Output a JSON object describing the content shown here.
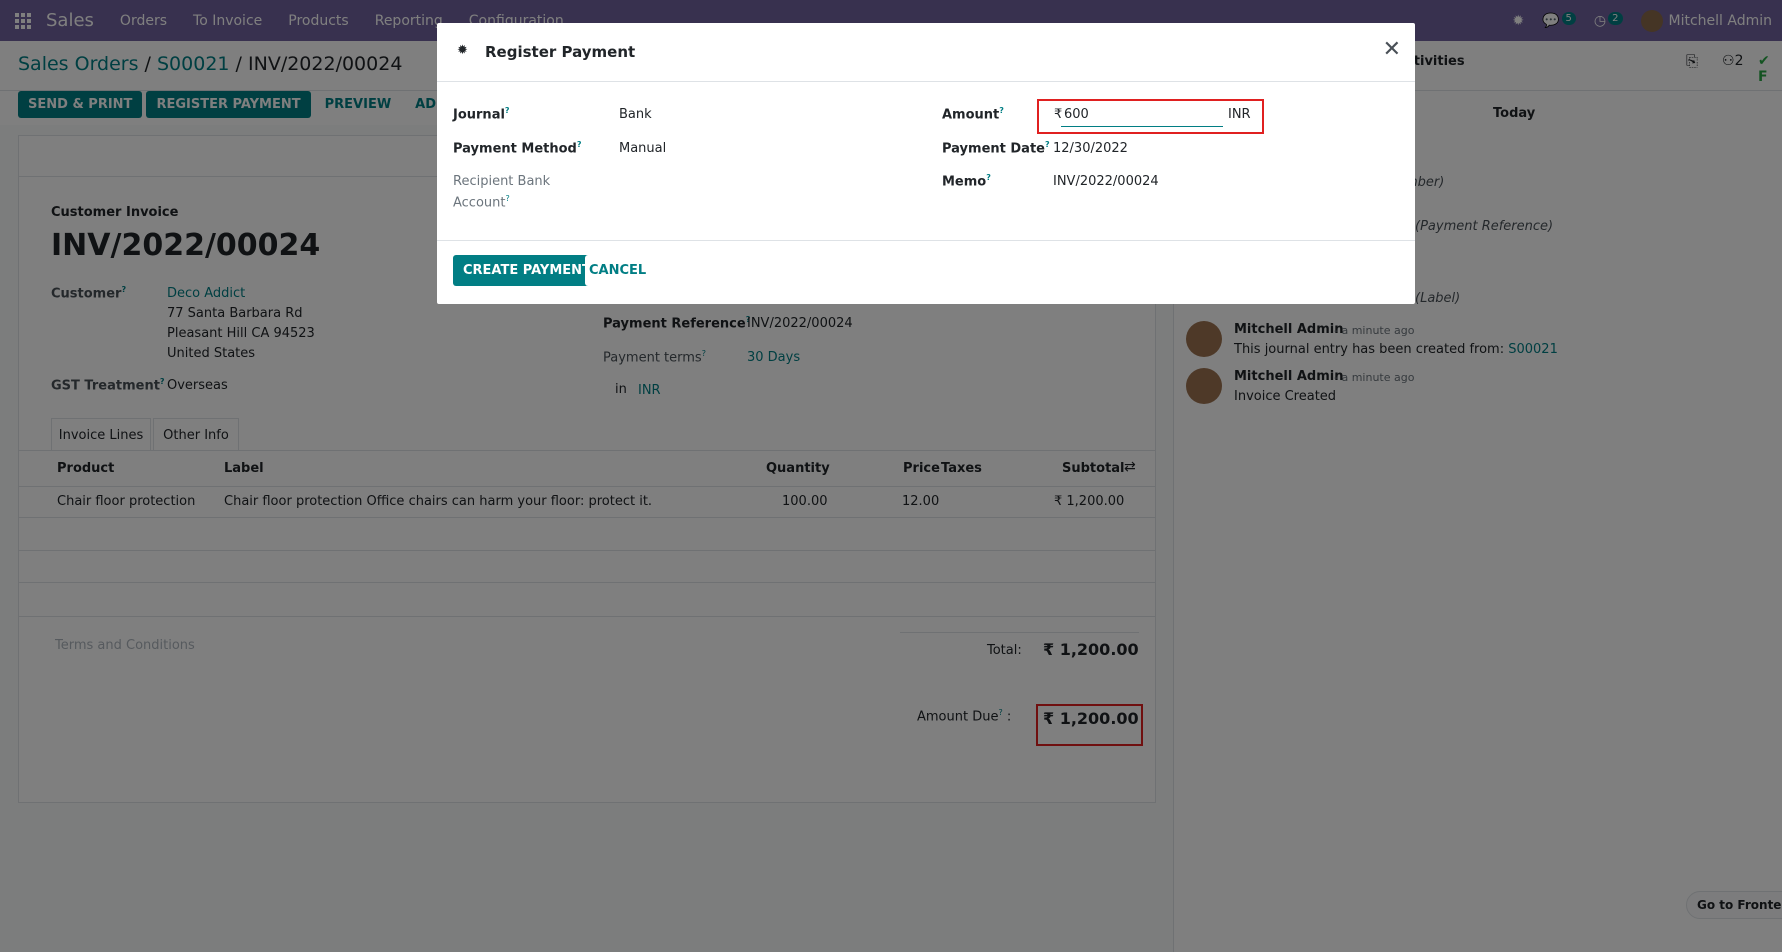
{
  "nav": {
    "brand": "Sales",
    "menus": [
      "Orders",
      "To Invoice",
      "Products",
      "Reporting",
      "Configuration"
    ],
    "messages_count": "5",
    "activities_count": "2",
    "user": "Mitchell Admin"
  },
  "breadcrumb": {
    "root": "Sales Orders",
    "order": "S00021",
    "current": "INV/2022/00024"
  },
  "toolbar": {
    "send_print": "SEND & PRINT",
    "register_payment": "REGISTER PAYMENT",
    "preview": "PREVIEW",
    "add_credit": "ADD CREDIT",
    "activities": "Activities",
    "followers": "2"
  },
  "invoice": {
    "type_label": "Customer Invoice",
    "number": "INV/2022/00024",
    "customer_label": "Customer",
    "customer_name": "Deco Addict",
    "address1": "77 Santa Barbara Rd",
    "address2": "Pleasant Hill CA 94523",
    "address3": "United States",
    "gst_label": "GST Treatment",
    "gst_value": "Overseas",
    "payment_ref_label": "Payment Reference",
    "payment_ref_value": "INV/2022/00024",
    "payment_terms_label": "Payment terms",
    "payment_terms_value": "30 Days",
    "currency_in": "in",
    "currency": "INR",
    "tabs": [
      "Invoice Lines",
      "Other Info"
    ],
    "columns": {
      "product": "Product",
      "label": "Label",
      "quantity": "Quantity",
      "price": "Price",
      "taxes": "Taxes",
      "subtotal": "Subtotal"
    },
    "line": {
      "product": "Chair floor protection",
      "label": "Chair floor protection Office chairs can harm your floor: protect it.",
      "quantity": "100.00",
      "price": "12.00",
      "subtotal": "₹ 1,200.00"
    },
    "terms_placeholder": "Terms and Conditions",
    "total_label": "Total:",
    "total_value": "₹ 1,200.00",
    "amount_due_label": "Amount Due",
    "amount_due_value": "₹ 1,200.00"
  },
  "chatter": {
    "today": "Today",
    "frag1": "mber)",
    "frag2": "(Payment Reference)",
    "frag3": "(Label)",
    "msg1_author": "Mitchell Admin",
    "msg1_time": "- a minute ago",
    "msg1_text": "This journal entry has been created from:",
    "msg1_link": "S00021",
    "msg2_author": "Mitchell Admin",
    "msg2_time": "- a minute ago",
    "msg2_text": "Invoice Created",
    "go_frontend": "Go to Frontend"
  },
  "modal": {
    "title": "Register Payment",
    "journal_label": "Journal",
    "journal_value": "Bank",
    "method_label": "Payment Method",
    "method_value": "Manual",
    "recipient_label_1": "Recipient Bank",
    "recipient_label_2": "Account",
    "amount_label": "Amount",
    "amount_symbol": "₹",
    "amount_value": "600",
    "amount_currency": "INR",
    "date_label": "Payment Date",
    "date_value": "12/30/2022",
    "memo_label": "Memo",
    "memo_value": "INV/2022/00024",
    "create_button": "CREATE PAYMENT",
    "cancel_button": "CANCEL"
  }
}
